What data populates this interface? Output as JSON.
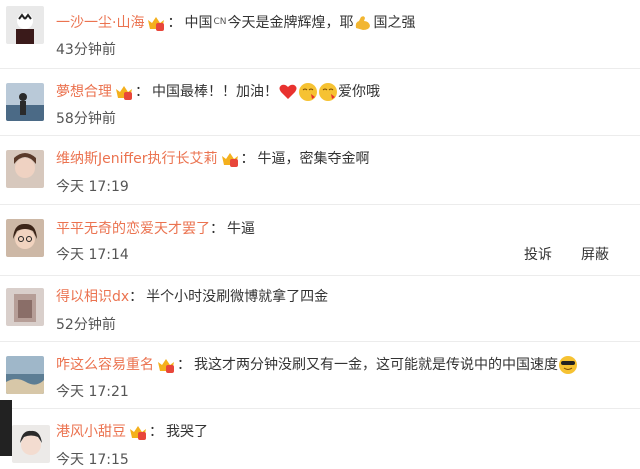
{
  "colors": {
    "name": "#eb7350",
    "text": "#333333",
    "time": "#555555",
    "separator": "#ececec"
  },
  "comments": [
    {
      "name": "一沙一尘·山海",
      "badge_icon": "vip-crown-icon",
      "parts": [
        "中国",
        "CN",
        " 今天是金牌辉煌，耶",
        "国之强"
      ],
      "time": "43分钟前"
    },
    {
      "name": "夢想合理",
      "badge_icon": "vip-crown-icon",
      "parts": [
        "中国最棒！！加油！",
        "爱你哦"
      ],
      "time": "58分钟前"
    },
    {
      "name": "维纳斯Jeniffer执行长艾莉",
      "badge_icon": "vip-crown-icon",
      "parts": [
        "牛逼，密集夺金啊"
      ],
      "time": "今天 17:19"
    },
    {
      "name": "平平无奇的恋爱天才罢了",
      "parts": [
        "牛逼"
      ],
      "time": "今天 17:14",
      "actions": [
        "投诉",
        "屏蔽"
      ]
    },
    {
      "name": "得以相识dx",
      "parts": [
        "半个小时没刷微博就拿了四金"
      ],
      "time": "52分钟前"
    },
    {
      "name": "咋这么容易重名",
      "badge_icon": "vip-crown-icon",
      "parts": [
        "我这才两分钟没刷又有一金，这可能就是传说中的中国速度"
      ],
      "time": "今天 17:21"
    },
    {
      "name": "港风小甜豆",
      "badge_icon": "vip-crown-icon",
      "parts": [
        "我哭了"
      ],
      "time": "今天 17:15"
    }
  ]
}
